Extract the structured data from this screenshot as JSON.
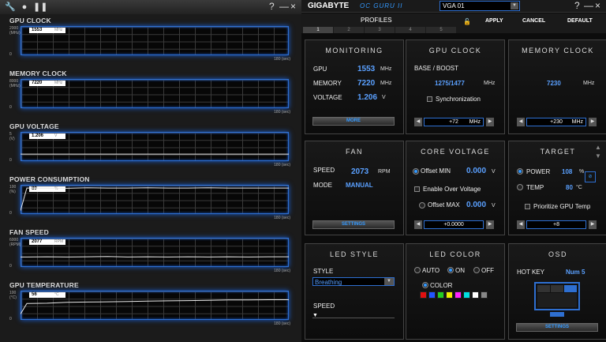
{
  "monitor": {
    "graphs": [
      {
        "title": "GPU CLOCK",
        "ymax": "2000",
        "yunit": "(MHz)",
        "y0": "0",
        "value": "1553",
        "unit": "MHz",
        "xlabel": "180 (sec)",
        "trace": []
      },
      {
        "title": "MEMORY CLOCK",
        "ymax": "8000",
        "yunit": "(MHz)",
        "y0": "0",
        "value": "7220",
        "unit": "MHz",
        "xlabel": "180 (sec)",
        "trace": []
      },
      {
        "title": "GPU VOLTAGE",
        "ymax": "5",
        "yunit": "(V)",
        "y0": "0",
        "value": "1.206",
        "unit": "V",
        "xlabel": "180 (sec)",
        "trace": [
          0.24,
          0.24,
          0.24,
          0.24
        ]
      },
      {
        "title": "POWER CONSUMPTION",
        "ymax": "100",
        "yunit": "(%)",
        "y0": "0",
        "value": "89",
        "unit": "%",
        "xlabel": "180 (sec)",
        "trace": [
          0.12,
          0.89,
          0.89,
          0.88,
          0.9,
          0.89,
          0.89,
          0.9,
          0.89,
          0.89,
          0.9,
          0.89,
          0.89,
          0.89,
          0.89
        ]
      },
      {
        "title": "FAN SPEED",
        "ymax": "6000",
        "yunit": "(RPM)",
        "y0": "0",
        "value": "2077",
        "unit": "RPM",
        "xlabel": "180 (sec)",
        "trace": [
          0.34,
          0.34,
          0.35,
          0.34,
          0.35,
          0.36,
          0.34,
          0.35,
          0.34,
          0.35,
          0.34,
          0.35,
          0.34,
          0.35,
          0.35
        ]
      },
      {
        "title": "GPU TEMPERATURE",
        "ymax": "100",
        "yunit": "(°C)",
        "y0": "0",
        "value": "56",
        "unit": "°C",
        "xlabel": "180 (sec)",
        "trace": [
          0.2,
          0.56,
          0.57,
          0.6,
          0.61,
          0.62,
          0.63,
          0.64,
          0.65,
          0.66,
          0.67,
          0.68,
          0.68,
          0.69,
          0.69
        ]
      }
    ]
  },
  "header": {
    "brand": "GIGABYTE",
    "product": "OC GURU II",
    "vga": "VGA 01",
    "help": "?",
    "min": "—",
    "close": "×"
  },
  "profiles": {
    "label": "PROFILES",
    "tabs": [
      "1",
      "2",
      "3",
      "4",
      "5"
    ],
    "apply": "APPLY",
    "cancel": "CANCEL",
    "default": "DEFAULT"
  },
  "monitoring": {
    "title": "MONITORING",
    "gpu_label": "GPU",
    "gpu_value": "1553",
    "gpu_unit": "MHz",
    "mem_label": "MEMORY",
    "mem_value": "7220",
    "mem_unit": "MHz",
    "volt_label": "VOLTAGE",
    "volt_value": "1.206",
    "volt_unit": "V",
    "more": "MORE"
  },
  "gpu_clock": {
    "title": "GPU CLOCK",
    "base_label": "BASE / BOOST",
    "value": "1275/1477",
    "unit": "MHz",
    "sync": "Synchronization",
    "offset": "+72",
    "offset_unit": "MHz"
  },
  "memory_clock": {
    "title": "MEMORY CLOCK",
    "value": "7230",
    "unit": "MHz",
    "offset": "+230",
    "offset_unit": "MHz"
  },
  "fan": {
    "title": "FAN",
    "speed_label": "SPEED",
    "speed_value": "2073",
    "speed_unit": "RPM",
    "mode_label": "MODE",
    "mode_value": "MANUAL",
    "settings": "SETTINGS"
  },
  "core_voltage": {
    "title": "CORE VOLTAGE",
    "offset_min": "Offset MIN",
    "offset_min_value": "0.000",
    "unit": "V",
    "enable": "Enable Over Voltage",
    "offset_max": "Offset MAX",
    "offset_max_value": "0.000",
    "spinner": "+0.0000"
  },
  "target": {
    "title": "TARGET",
    "power_label": "POWER",
    "power_value": "108",
    "power_unit": "%",
    "temp_label": "TEMP",
    "temp_value": "80",
    "temp_unit": "°C",
    "prioritize": "Prioritize GPU Temp",
    "spinner": "+8"
  },
  "led_style": {
    "title": "LED STYLE",
    "style_label": "STYLE",
    "style_value": "Breathing",
    "speed_label": "SPEED"
  },
  "led_color": {
    "title": "LED COLOR",
    "auto": "AUTO",
    "on": "ON",
    "off": "OFF",
    "color": "COLOR",
    "swatches": [
      "#e01010",
      "#2255ff",
      "#22cc22",
      "#eeee00",
      "#ff22ff",
      "#00e0e0",
      "#ffffff",
      "#888888"
    ]
  },
  "osd": {
    "title": "OSD",
    "hotkey_label": "HOT KEY",
    "hotkey_value": "Num 5",
    "settings": "SETTINGS"
  }
}
